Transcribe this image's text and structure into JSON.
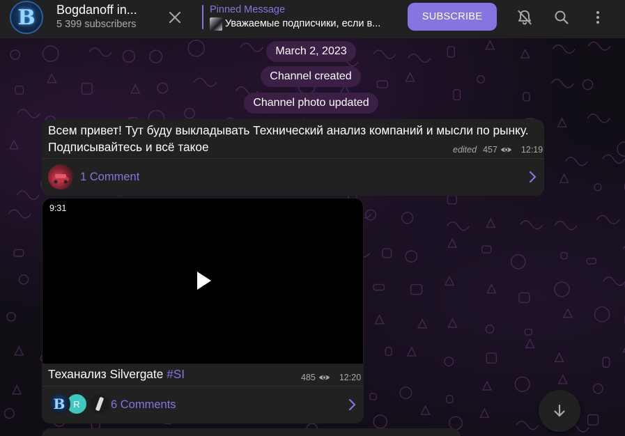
{
  "header": {
    "avatar_letter": "B",
    "channel_title": "Bogdanoff in...",
    "subscribers": "5 399 subscribers",
    "pinned_label": "Pinned Message",
    "pinned_text": "Уважаемые подписчики, если в...",
    "subscribe_label": "SUBSCRIBE",
    "icons": [
      "close-icon",
      "bell-off-icon",
      "search-icon",
      "more-vertical-icon"
    ]
  },
  "service_messages": [
    {
      "text": "March 2, 2023"
    },
    {
      "text": "Channel created"
    },
    {
      "text": "Channel photo updated"
    }
  ],
  "messages": [
    {
      "text": "Всем привет! Тут буду выкладывать Технический анализ компаний и мысли по рынку. Подписывайтесь и всё такое",
      "edited_label": "edited",
      "views": "457",
      "time": "12:19",
      "comments_label": "1 Comment"
    },
    {
      "video_duration": "9:31",
      "caption_text": "Теханализ Silvergate ",
      "caption_hashtag": "#SI",
      "views": "485",
      "time": "12:20",
      "comments_label": "6 Comments",
      "commenter_initial": "R"
    }
  ],
  "colors": {
    "accent": "#8774e1",
    "header_bg": "#212121",
    "bubble_bg": "#212121",
    "service_pill_bg": "#3b1f45"
  }
}
